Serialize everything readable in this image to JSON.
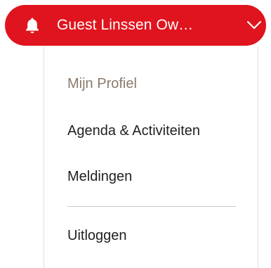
{
  "account": {
    "label": "Guest Linssen Ow…",
    "bell_icon": "bell-icon",
    "chevron_icon": "chevron-down-icon",
    "background_color": "#e0141e",
    "text_color": "#ffffff"
  },
  "menu": {
    "items": [
      {
        "label": "Mijn Profiel",
        "state": "active",
        "color": "#8a7a6b"
      },
      {
        "label": "Agenda & Activiteiten",
        "state": "default",
        "color": "#222222"
      },
      {
        "label": "Meldingen",
        "state": "default",
        "color": "#222222"
      },
      {
        "label": "Uitloggen",
        "state": "default",
        "color": "#222222"
      }
    ]
  }
}
